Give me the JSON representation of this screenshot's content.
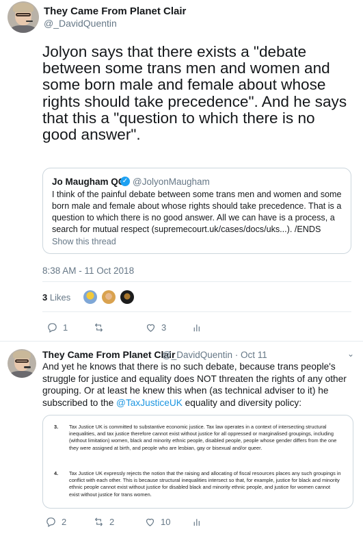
{
  "tweet1": {
    "name": "They Came From Planet Clair",
    "handle": "@_DavidQuentin",
    "text": "Jolyon says that there exists a \"debate between some trans men and women and some born male and female about whose rights should take precedence\". And he says that this a \"question to which there is no good answer\".",
    "quoted": {
      "name": "Jo Maugham QC",
      "verified_icon": "verified-badge-icon",
      "handle": "@JolyonMaugham",
      "text": "I think of the painful debate between some trans men and women and some born male and female about whose rights should take precedence. That is a question to which there is no good answer. All we can have is a process, a search for mutual respect (supremecourt.uk/cases/docs/uks...). /ENDS",
      "show_thread": "Show this thread"
    },
    "timestamp": "8:38 AM - 11 Oct 2018",
    "likes_number": "3",
    "likes_word": "Likes",
    "actions": {
      "reply_count": "1",
      "retweet_count": "",
      "like_count": "3"
    }
  },
  "tweet2": {
    "name": "They Came From Planet Clair",
    "handle_date": "@_DavidQuentin · Oct 11",
    "text_before": "And yet he knows that there is no such debate, because trans people's struggle for justice and equality does NOT threaten the rights of any other grouping. Or at least he knew this when (as technical adviser to it) he subscribed to the ",
    "mention": "@TaxJusticeUK",
    "text_after": " equality and diversity policy:",
    "doc": {
      "items": [
        {
          "num": "3.",
          "text": "Tax Justice UK is committed to substantive economic justice. Tax law operates in a context of intersecting structural inequalities, and tax justice therefore cannot exist without justice for all oppressed or marginalised groupings, including (without limitation) women, black and minority ethnic people, disabled people, people whose gender differs from the one they were assigned at birth, and people who are lesbian, gay or bisexual and/or queer."
        },
        {
          "num": "4.",
          "text": "Tax Justice UK expressly rejects the notion that the raising and allocating of fiscal resources places any such groupings in conflict with each other. This is because structural inequalities intersect so that, for example, justice for black and minority ethnic people cannot exist without justice for disabled black and minority ethnic people, and justice for women cannot exist without justice for trans women."
        }
      ]
    },
    "actions": {
      "reply_count": "2",
      "retweet_count": "2",
      "like_count": "10"
    }
  },
  "icons": [
    "reply-icon",
    "retweet-icon",
    "like-icon",
    "analytics-icon"
  ],
  "colors": {
    "link": "#1b95e0",
    "muted": "#657786",
    "verified": "#1da1f2",
    "border": "#ccd6dd"
  }
}
